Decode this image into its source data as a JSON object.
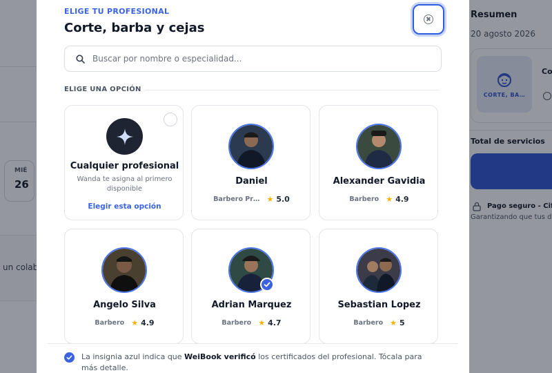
{
  "background": {
    "day": {
      "dow": "MIÉ",
      "num": "26"
    },
    "left_partial_text": "un colab",
    "summary": {
      "heading": "Resumen",
      "date": "20 agosto 2026",
      "service_tile_label": "CORTE, BA…",
      "service_title_partial": "Co",
      "total_label": "Total de servicios",
      "secure_title": "Pago seguro - Cifr",
      "secure_sub": "Garantizando que tus da"
    }
  },
  "modal": {
    "kicker": "ELIGE TU PROFESIONAL",
    "title": "Corte, barba y cejas",
    "search": {
      "placeholder": "Buscar por nombre o especialidad..."
    },
    "section_label": "ELIGE UNA OPCIÓN",
    "any_option": {
      "name": "Cualquier profesional",
      "description": "Wanda te asigna al primero disponible",
      "link": "Elegir esta opción"
    },
    "professionals": [
      {
        "name": "Daniel",
        "role": "Barbero Pr…",
        "rating": "5.0",
        "verified": false,
        "bg": "#2b3a4f"
      },
      {
        "name": "Alexander Gavidia",
        "role": "Barbero",
        "rating": "4.9",
        "verified": false,
        "bg": "#3a4a3e"
      },
      {
        "name": "Angelo Silva",
        "role": "Barbero",
        "rating": "4.9",
        "verified": false,
        "bg": "#4a4030"
      },
      {
        "name": "Adrian Marquez",
        "role": "Barbero",
        "rating": "4.7",
        "verified": true,
        "bg": "#2f4a44"
      },
      {
        "name": "Sebastian Lopez",
        "role": "Barbero",
        "rating": "5",
        "verified": false,
        "bg": "#3b3b4a"
      }
    ],
    "footer": {
      "pre": "La insignia azul indica que ",
      "brand": "WeiBook verificó",
      "post": " los certificados del profesional. Tócala para más detalle."
    }
  },
  "icons": {
    "search": "search-icon",
    "close": "close-icon",
    "sparkle": "sparkle-icon",
    "star": "star-icon",
    "verified": "verified-badge-icon"
  },
  "colors": {
    "accent": "#3b63e0",
    "star": "#f5b301",
    "text": "#111827"
  }
}
